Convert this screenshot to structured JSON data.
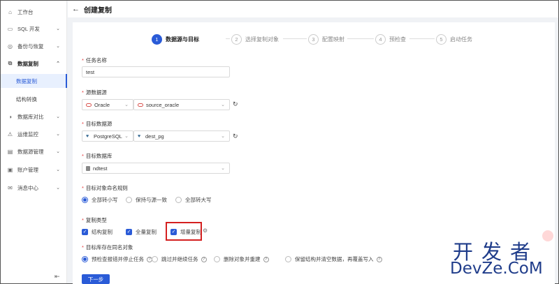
{
  "sidebar": {
    "items": [
      {
        "label": "工作台",
        "icon": "home-icon",
        "glyph": "⌂"
      },
      {
        "label": "SQL 开发",
        "icon": "terminal-icon",
        "glyph": "▭"
      },
      {
        "label": "备份与恢复",
        "icon": "backup-icon",
        "glyph": "◎"
      },
      {
        "label": "数据复制",
        "icon": "copy-icon",
        "glyph": "⧉"
      },
      {
        "label": "数据复制",
        "icon": "",
        "glyph": ""
      },
      {
        "label": "结构转换",
        "icon": "",
        "glyph": ""
      },
      {
        "label": "数据库对比",
        "icon": "compare-icon",
        "glyph": "◑"
      },
      {
        "label": "运维监控",
        "icon": "monitor-icon",
        "glyph": "⚠"
      },
      {
        "label": "数据源管理",
        "icon": "datasource-icon",
        "glyph": "▤"
      },
      {
        "label": "账户管理",
        "icon": "account-icon",
        "glyph": "▣"
      },
      {
        "label": "消息中心",
        "icon": "message-icon",
        "glyph": "✉"
      }
    ],
    "collapse_glyph": "⇤"
  },
  "header": {
    "back_glyph": "←",
    "title": "创建复制"
  },
  "steps": [
    {
      "num": "1",
      "label": "数据源与目标"
    },
    {
      "num": "2",
      "label": "选择复制对象"
    },
    {
      "num": "3",
      "label": "配置映射"
    },
    {
      "num": "4",
      "label": "预检查"
    },
    {
      "num": "5",
      "label": "启动任务"
    }
  ],
  "form": {
    "task_name_label": "任务名称",
    "task_name_value": "test",
    "source_label": "源数据源",
    "source_type": "Oracle",
    "source_name": "source_oracle",
    "target_label": "目标数据源",
    "target_type": "PostgreSQL",
    "target_name": "dest_pg",
    "target_db_label": "目标数据库",
    "target_db_value": "ndtest",
    "naming_label": "目标对象命名规则",
    "naming_options": [
      "全部转小写",
      "保持与源一致",
      "全部转大写"
    ],
    "copy_type_label": "复制类型",
    "copy_types": [
      "结构复制",
      "全量复制",
      "增量复制"
    ],
    "conflict_label": "目标库存在同名对象",
    "conflict_options": [
      "预检查报错并停止任务",
      "跳过并继续任务",
      "删除对象并重建",
      "保留结构并清空数据，再覆盖写入"
    ],
    "next_label": "下一步"
  },
  "colors": {
    "accent": "#2a5bd7",
    "highlight": "#d42020",
    "required": "#e4393c"
  },
  "watermark": {
    "line1": "开发者",
    "line2": "DevZe.CoM"
  }
}
